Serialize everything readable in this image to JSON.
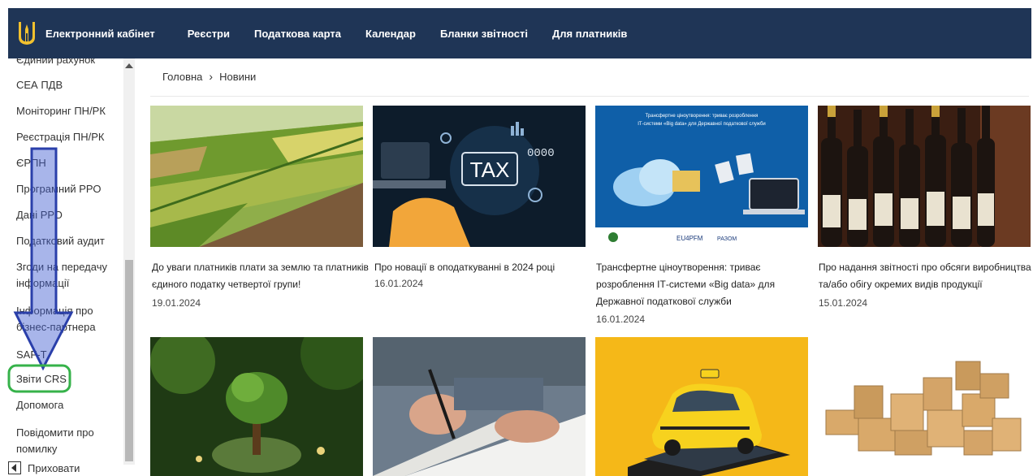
{
  "nav": {
    "brand": "Електронний кабінет",
    "items": [
      "Реєстри",
      "Податкова карта",
      "Календар",
      "Бланки звітності",
      "Для платників"
    ]
  },
  "sidebar": {
    "items": [
      {
        "label": "Єдиний рахунок"
      },
      {
        "label": "СЕА ПДВ"
      },
      {
        "label": "Моніторинг ПН/РК"
      },
      {
        "label": "Реєстрація ПН/РК"
      },
      {
        "label": "ЄРПН"
      },
      {
        "label": "Програмний РРО"
      },
      {
        "label": "Дані РРО"
      },
      {
        "label": "Податковий аудит"
      },
      {
        "label": "Згоди на передачу інформації"
      },
      {
        "label": "Інформація про бізнес-партнера"
      },
      {
        "label": "SAF-T"
      },
      {
        "label": "Звіти CRS"
      },
      {
        "label": "Допомога"
      },
      {
        "label": "Повідомити про помилку"
      }
    ],
    "hide_label": "Приховати"
  },
  "breadcrumb": {
    "home": "Головна",
    "current": "Новини"
  },
  "news": [
    {
      "title": "До уваги платників плати за землю та платників єдиного податку четвертої групи!",
      "date": "19.01.2024",
      "image": "farm-fields-aerial"
    },
    {
      "title": "Про новації в оподаткуванні в 2024 році",
      "date": "16.01.2024",
      "image": "tax-laptop",
      "image_text": "TAX"
    },
    {
      "title": "Трансфертне ціноутворення: триває розроблення ІТ-системи «Big data» для Державної податкової служби",
      "date": "16.01.2024",
      "image": "cloud-data-transfer",
      "image_caption": "Трансфертне ціноутворення: триває розроблення ІТ-системи «Big data» для Державної податкової служби",
      "image_footer": [
        "EU4PFM",
        "РАЗОМ"
      ]
    },
    {
      "title": "Про надання звітності про обсяги виробництва та/або обігу окремих видів продукції",
      "date": "15.01.2024",
      "image": "wine-bottles"
    },
    {
      "title": "",
      "date": "",
      "image": "tree-globe"
    },
    {
      "title": "",
      "date": "",
      "image": "hand-writing"
    },
    {
      "title": "",
      "date": "",
      "image": "taxi-phone"
    },
    {
      "title": "",
      "date": "",
      "image": "cardboard-boxes"
    }
  ],
  "colors": {
    "nav_bg": "#1f3556",
    "arrow": "#3d5bd0",
    "highlight": "#36b24a"
  }
}
